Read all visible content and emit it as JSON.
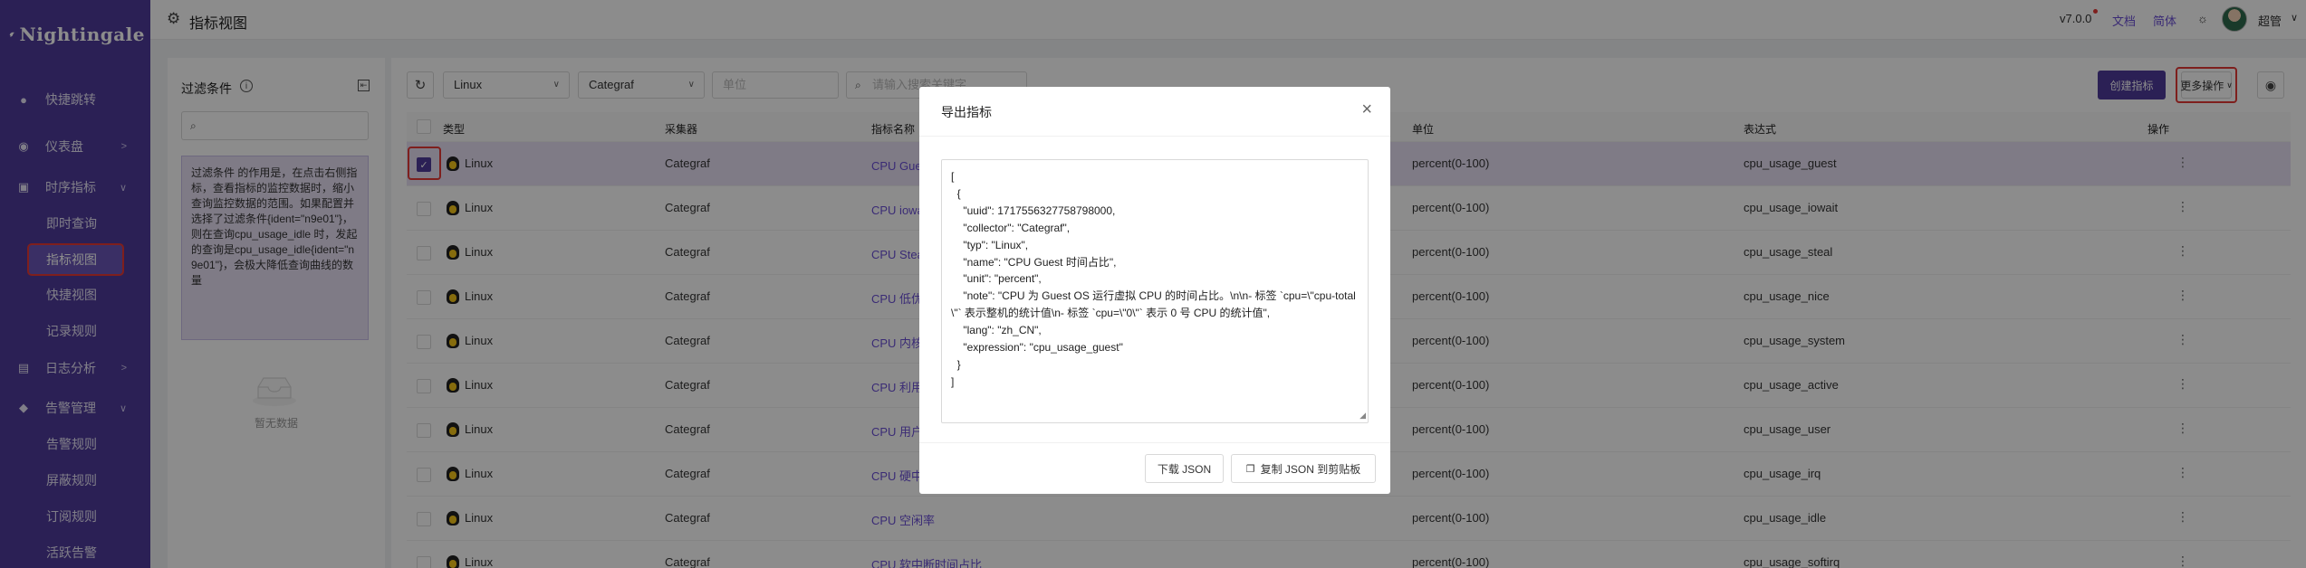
{
  "app": {
    "name": "Nightingale"
  },
  "header": {
    "title": "指标视图",
    "version": "v7.0.0",
    "docs": "文档",
    "lang": "简体",
    "user": "超管"
  },
  "sidebar": {
    "items": [
      {
        "label": "快捷跳转",
        "icon": "rocket-icon"
      },
      {
        "label": "仪表盘",
        "icon": "dashboard-icon"
      },
      {
        "label": "时序指标",
        "icon": "chart-icon"
      },
      {
        "label": "即时查询"
      },
      {
        "label": "指标视图"
      },
      {
        "label": "快捷视图"
      },
      {
        "label": "记录规则"
      },
      {
        "label": "日志分析",
        "icon": "log-icon"
      },
      {
        "label": "告警管理",
        "icon": "alarm-icon"
      },
      {
        "label": "告警规则"
      },
      {
        "label": "屏蔽规则"
      },
      {
        "label": "订阅规则"
      },
      {
        "label": "活跃告警"
      }
    ]
  },
  "filter": {
    "title": "过滤条件",
    "search_placeholder": "",
    "note": "过滤条件 的作用是，在点击右侧指标，查看指标的监控数据时，缩小查询监控数据的范围。如果配置并选择了过滤条件{ident=\"n9e01\"}，则在查询cpu_usage_idle 时，发起的查询是cpu_usage_idle{ident=\"n9e01\"}，会极大降低查询曲线的数量",
    "empty": "暂无数据"
  },
  "toolbar": {
    "type_value": "Linux",
    "collector_value": "Categraf",
    "unit_placeholder": "单位",
    "search_placeholder": "请输入搜索关键字",
    "create": "创建指标",
    "more": "更多操作"
  },
  "table": {
    "headers": [
      "类型",
      "采集器",
      "指标名称",
      "单位",
      "表达式",
      "操作"
    ],
    "rows": [
      {
        "type": "Linux",
        "collector": "Categraf",
        "name": "CPU Guest 时间占比",
        "unit": "percent(0-100)",
        "expr": "cpu_usage_guest",
        "checked": true
      },
      {
        "type": "Linux",
        "collector": "Categraf",
        "name": "CPU iowait 时间占比",
        "unit": "percent(0-100)",
        "expr": "cpu_usage_iowait",
        "checked": false
      },
      {
        "type": "Linux",
        "collector": "Categraf",
        "name": "CPU Steal 时间占比",
        "unit": "percent(0-100)",
        "expr": "cpu_usage_steal",
        "checked": false
      },
      {
        "type": "Linux",
        "collector": "Categraf",
        "name": "CPU 低优先级用户态时间占比",
        "unit": "percent(0-100)",
        "expr": "cpu_usage_nice",
        "checked": false
      },
      {
        "type": "Linux",
        "collector": "Categraf",
        "name": "CPU 内核态时间占比",
        "unit": "percent(0-100)",
        "expr": "cpu_usage_system",
        "checked": false
      },
      {
        "type": "Linux",
        "collector": "Categraf",
        "name": "CPU 利用率",
        "unit": "percent(0-100)",
        "expr": "cpu_usage_active",
        "checked": false
      },
      {
        "type": "Linux",
        "collector": "Categraf",
        "name": "CPU 用户态时间占比",
        "unit": "percent(0-100)",
        "expr": "cpu_usage_user",
        "checked": false
      },
      {
        "type": "Linux",
        "collector": "Categraf",
        "name": "CPU 硬中断时间占比",
        "unit": "percent(0-100)",
        "expr": "cpu_usage_irq",
        "checked": false
      },
      {
        "type": "Linux",
        "collector": "Categraf",
        "name": "CPU 空闲率",
        "unit": "percent(0-100)",
        "expr": "cpu_usage_idle",
        "checked": false
      },
      {
        "type": "Linux",
        "collector": "Categraf",
        "name": "CPU 软中断时间占比",
        "unit": "percent(0-100)",
        "expr": "cpu_usage_softirq",
        "checked": false
      }
    ]
  },
  "modal": {
    "title": "导出指标",
    "json": "[\n  {\n    \"uuid\": 1717556327758798000,\n    \"collector\": \"Categraf\",\n    \"typ\": \"Linux\",\n    \"name\": \"CPU Guest 时间占比\",\n    \"unit\": \"percent\",\n    \"note\": \"CPU 为 Guest OS 运行虚拟 CPU 的时间占比。\\n\\n- 标签 `cpu=\\\"cpu-total\\\"` 表示整机的统计值\\n- 标签 `cpu=\\\"0\\\"` 表示 0 号 CPU 的统计值\",\n    \"lang\": \"zh_CN\",\n    \"expression\": \"cpu_usage_guest\"\n  }\n]",
    "download": "下载 JSON",
    "copy": "复制 JSON 到剪贴板"
  },
  "colors": {
    "brand": "#4f3b9c",
    "link": "#6b4fd6",
    "highlight": "#e53935",
    "selected_row": "#e7e0f5"
  }
}
